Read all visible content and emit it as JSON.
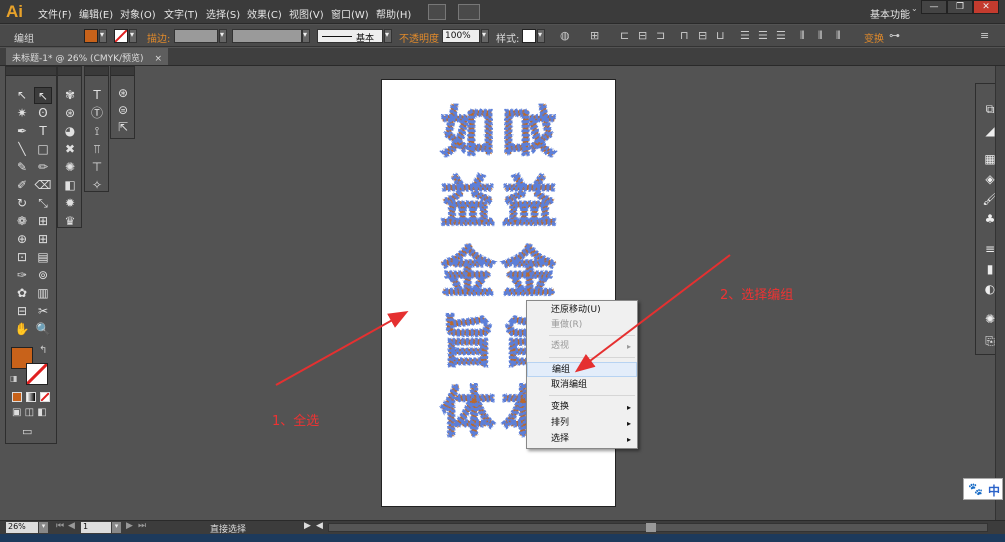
{
  "app": {
    "logo": "Ai",
    "workspace": "基本功能"
  },
  "menu": [
    "文件(F)",
    "编辑(E)",
    "对象(O)",
    "文字(T)",
    "选择(S)",
    "效果(C)",
    "视图(V)",
    "窗口(W)",
    "帮助(H)"
  ],
  "window_controls": {
    "minimize": "—",
    "restore": "❐",
    "close": "✕"
  },
  "control_bar": {
    "selection_label": "编组",
    "stroke_label": "描边:",
    "stroke_style": "基本",
    "opacity_label": "不透明度",
    "opacity_value": "100%",
    "style_label": "样式:",
    "transform_label": "变换"
  },
  "doc_tab": {
    "title": "未标题-1* @ 26% (CMYK/预览)",
    "close": "×"
  },
  "colors": {
    "fill": "#c8621a",
    "accent_orange": "#e08a2b",
    "annotation_red": "#e53030",
    "glyph_stroke": "#5b7fd9",
    "glyph_fill": "#b8692e"
  },
  "tool_panel_icons": [
    "selection-tool",
    "direct-selection-tool",
    "magic-wand-tool",
    "lasso-tool",
    "pen-tool",
    "type-tool",
    "line-tool",
    "rectangle-tool",
    "paintbrush-tool",
    "pencil-tool",
    "blob-brush-tool",
    "eraser-tool",
    "rotate-tool",
    "scale-tool",
    "warp-tool",
    "free-transform-tool",
    "shape-builder-tool",
    "perspective-grid-tool",
    "mesh-tool",
    "gradient-tool",
    "eyedropper-tool",
    "blend-tool",
    "symbol-sprayer-tool",
    "column-graph-tool",
    "artboard-tool",
    "slice-tool",
    "hand-tool",
    "zoom-tool"
  ],
  "tool_glyphs": [
    "↖",
    "↖",
    "✷",
    "ʘ",
    "✒",
    "T",
    "╲",
    "□",
    "✎",
    "✏",
    "✐",
    "⌫",
    "↻",
    "⤡",
    "❁",
    "⊞",
    "⊕",
    "⊞",
    "⊡",
    "▤",
    "✑",
    "⊚",
    "✿",
    "▥",
    "⊟",
    "✂",
    "✋",
    "🔍"
  ],
  "artboard_glyphs": [
    "如",
    "益",
    "金",
    "旨",
    "体"
  ],
  "context_menu": {
    "undo": "还原移动(U)",
    "redo": "重做(R)",
    "perspective": "透视",
    "group": "编组",
    "ungroup": "取消编组",
    "transform": "变换",
    "arrange": "排列",
    "select": "选择"
  },
  "annotations": {
    "step1": "1、全选",
    "step2": "2、选择编组"
  },
  "status_bar": {
    "zoom": "26%",
    "page": "1",
    "tool": "直接选择"
  },
  "ime": {
    "label": "中",
    "icon": "paw-icon"
  }
}
